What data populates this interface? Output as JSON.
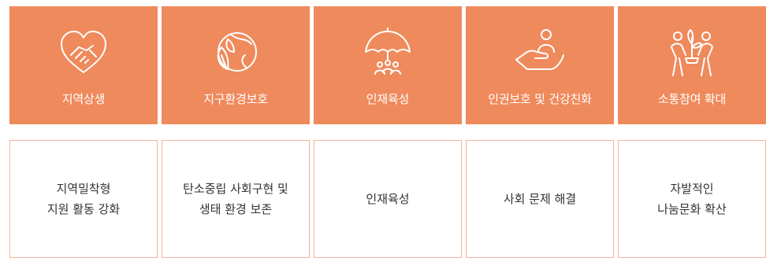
{
  "colors": {
    "accent": "#ef8a5c",
    "border": "#f2b49b",
    "text": "#333333"
  },
  "tiles": [
    {
      "label": "지역상생",
      "icon": "handshake-heart-icon"
    },
    {
      "label": "지구환경보호",
      "icon": "leaf-globe-icon"
    },
    {
      "label": "인재육성",
      "icon": "umbrella-people-icon"
    },
    {
      "label": "인권보호 및 건강친화",
      "icon": "hand-person-icon"
    },
    {
      "label": "소통참여 확대",
      "icon": "people-plant-icon"
    }
  ],
  "cards": [
    {
      "text": "지역밀착형\n지원 활동 강화"
    },
    {
      "text": "탄소중립 사회구현 및\n생태 환경 보존"
    },
    {
      "text": "인재육성"
    },
    {
      "text": "사회 문제 해결"
    },
    {
      "text": "자발적인\n나눔문화 확산"
    }
  ]
}
